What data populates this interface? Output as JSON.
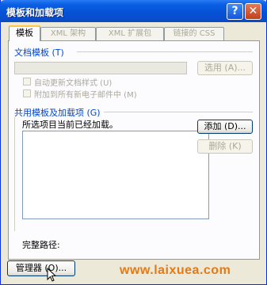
{
  "window": {
    "title": "模板和加载项",
    "help_glyph": "?",
    "close_glyph": "✕"
  },
  "tabs": [
    {
      "label": "模板",
      "active": true
    },
    {
      "label": "XML 架构",
      "active": false
    },
    {
      "label": "XML 扩展包",
      "active": false
    },
    {
      "label": "链接的 CSS",
      "active": false
    }
  ],
  "document_template": {
    "group_label": "文档模板 (T)",
    "path_value": "",
    "select_button": "选用 (A)...",
    "auto_update_label": "自动更新文档样式 (U)",
    "attach_email_label": "附加到所有新电子邮件中 (M)"
  },
  "global_templates": {
    "group_label": "共用模板及加载项 (G)",
    "status_text": "所选项目当前已经加载。",
    "add_button": "添加 (D)...",
    "remove_button": "删除 (K)"
  },
  "full_path_label": "完整路径:",
  "organizer_button": "管理器 (O)...",
  "watermark": "www.laixuea.com"
}
